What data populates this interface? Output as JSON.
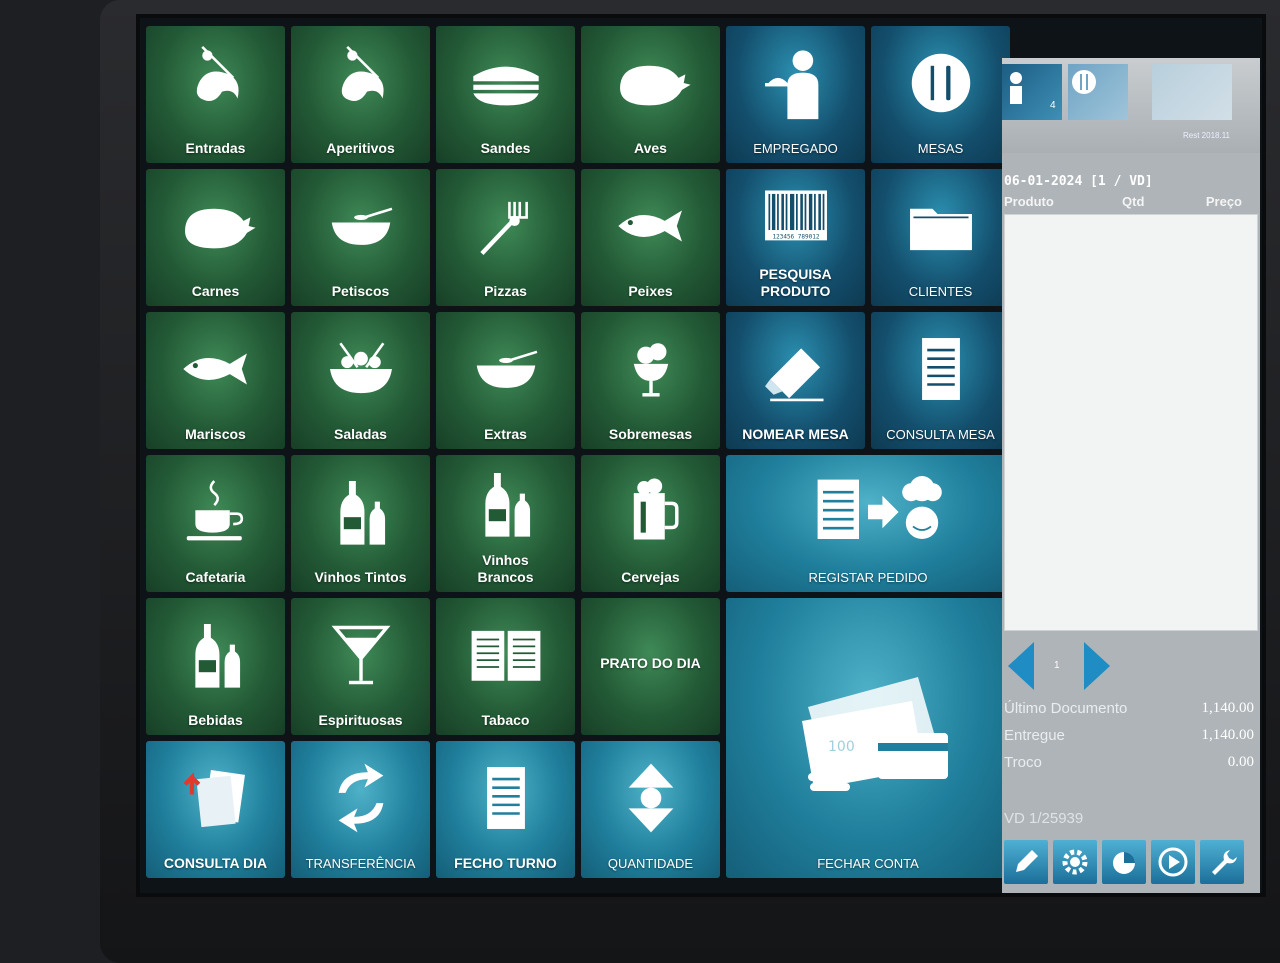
{
  "tiles": {
    "entradas": "Entradas",
    "aperitivos": "Aperitivos",
    "sandes": "Sandes",
    "aves": "Aves",
    "empregado": "EMPREGADO",
    "mesas": "MESAS",
    "carnes": "Carnes",
    "petiscos": "Petiscos",
    "pizzas": "Pizzas",
    "peixes": "Peixes",
    "pesquisa_produto": "PESQUISA PRODUTO",
    "clientes": "CLIENTES",
    "mariscos": "Mariscos",
    "saladas": "Saladas",
    "extras": "Extras",
    "sobremesas": "Sobremesas",
    "nomear_mesa": "NOMEAR MESA",
    "consulta_mesa": "CONSULTA MESA",
    "cafetaria": "Cafetaria",
    "vinhos_tintos": "Vinhos Tintos",
    "vinhos_brancos": "Vinhos Brancos",
    "cervejas": "Cervejas",
    "registar_pedido": "REGISTAR PEDIDO",
    "bebidas": "Bebidas",
    "espirituosas": "Espirituosas",
    "tabaco": "Tabaco",
    "prato_do_dia": "PRATO DO DIA",
    "consulta_dia": "CONSULTA DIA",
    "transferencia": "TRANSFERÊNCIA",
    "fecho_turno": "FECHO TURNO",
    "quantidade": "QUANTIDADE",
    "fechar_conta": "FECHAR CONTA",
    "barcode_digits": "123456 789012",
    "banknote_value": "100"
  },
  "panel": {
    "tab_count": "4",
    "rest_label": "Rest 2018.11",
    "doc_line": "06-01-2024 [1 / VD]",
    "col_produto": "Produto",
    "col_qtd": "Qtd",
    "col_preco": "Preço",
    "page": "1",
    "ultimo_label": "Último Documento",
    "ultimo_value": "1,140.00",
    "entregue_label": "Entregue",
    "entregue_value": "1,140.00",
    "troco_label": "Troco",
    "troco_value": "0.00",
    "vd_number": "VD 1/25939"
  }
}
